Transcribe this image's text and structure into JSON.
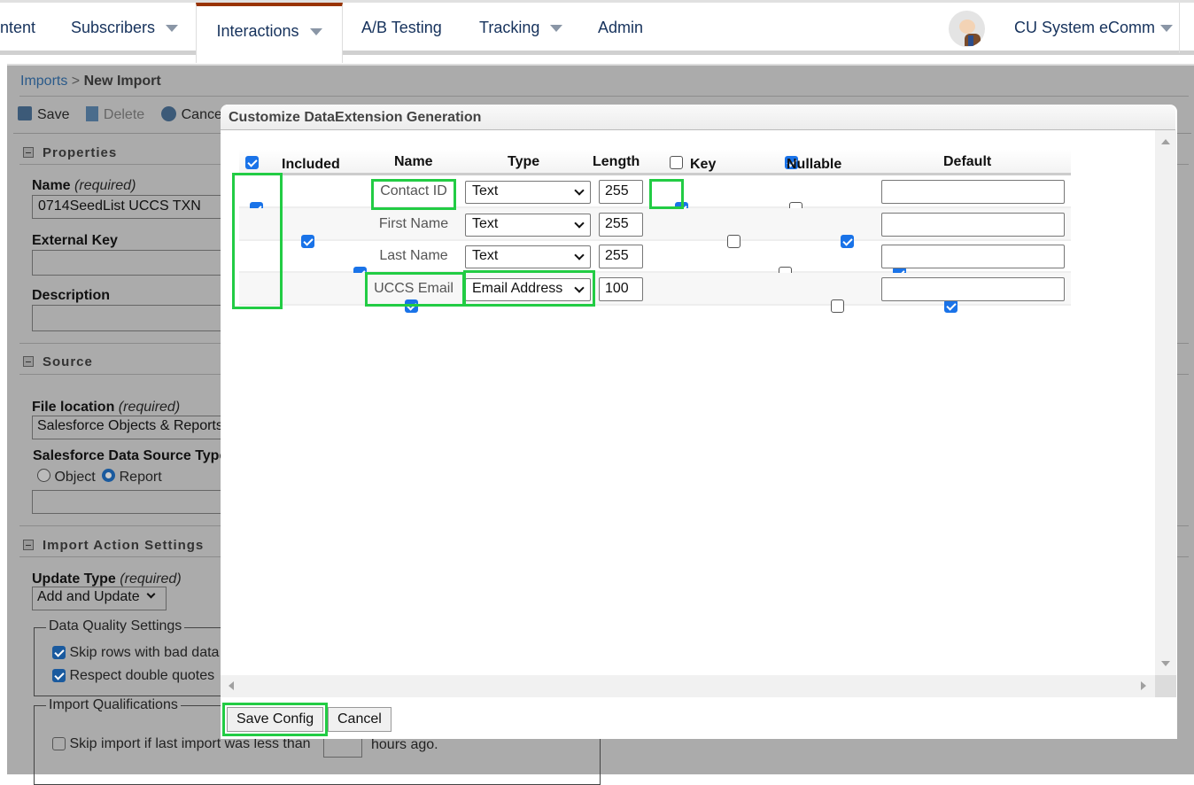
{
  "nav": {
    "tabs": [
      {
        "label": "ntent"
      },
      {
        "label": "Subscribers",
        "caret": true
      },
      {
        "label": "Interactions",
        "caret": true,
        "active": true
      },
      {
        "label": "A/B Testing"
      },
      {
        "label": "Tracking",
        "caret": true
      },
      {
        "label": "Admin"
      }
    ],
    "user": "CU System eComm",
    "accent": "#993300"
  },
  "breadcrumb": {
    "parent": "Imports",
    "sep": ">",
    "current": "New Import"
  },
  "toolbar": {
    "save": "Save",
    "delete": "Delete",
    "cancel": "Cancel"
  },
  "properties": {
    "title": "Properties",
    "name_label": "Name",
    "required": "(required)",
    "name_value": "0714SeedList UCCS TXN",
    "external_key_label": "External Key",
    "description_label": "Description"
  },
  "source": {
    "title": "Source",
    "file_location_label": "File location",
    "file_location_value": "Salesforce Objects & Reports",
    "ds_type_label": "Salesforce Data Source Type",
    "option_object": "Object",
    "option_report": "Report",
    "selected": "Report"
  },
  "import_action": {
    "title": "Import Action Settings",
    "update_type_label": "Update Type",
    "update_type_value": "Add and Update",
    "dq_legend": "Data Quality Settings",
    "skip_bad": "Skip rows with bad data",
    "respect_quotes": "Respect double quotes",
    "iq_legend": "Import Qualifications",
    "skip_import": "Skip import if last import was less than",
    "hours_ago": "hours ago."
  },
  "modal": {
    "title": "Customize DataExtension Generation",
    "headers": {
      "included": "Included",
      "name": "Name",
      "type": "Type",
      "length": "Length",
      "key": "Key",
      "nullable": "Nullable",
      "default": "Default"
    },
    "header_checks": {
      "included": true,
      "key": false,
      "nullable": true
    },
    "rows": [
      {
        "included": true,
        "name": "Contact ID",
        "type": "Text",
        "length": "255",
        "key": true,
        "nullable": false,
        "default": ""
      },
      {
        "included": true,
        "name": "First Name",
        "type": "Text",
        "length": "255",
        "key": false,
        "nullable": true,
        "default": ""
      },
      {
        "included": true,
        "name": "Last Name",
        "type": "Text",
        "length": "255",
        "key": false,
        "nullable": true,
        "default": ""
      },
      {
        "included": true,
        "name": "UCCS Email",
        "type": "Email Address",
        "length": "100",
        "key": false,
        "nullable": true,
        "default": ""
      }
    ],
    "save_config": "Save Config",
    "cancel": "Cancel",
    "highlight_color": "#22cc44"
  }
}
